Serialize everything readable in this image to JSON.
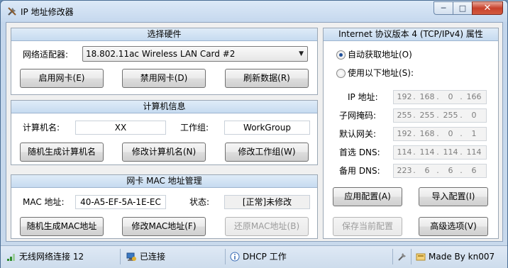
{
  "window": {
    "title": "IP 地址修改器",
    "controls": {
      "minimize": "─",
      "maximize": "□",
      "close": "✕"
    }
  },
  "hardware": {
    "header": "选择硬件",
    "adapter_label": "网络适配器:",
    "adapter_value": "18.802.11ac Wireless LAN Card #2",
    "buttons": {
      "enable": "启用网卡(E)",
      "disable": "禁用网卡(D)",
      "refresh": "刷新数据(R)"
    }
  },
  "computer": {
    "header": "计算机信息",
    "name_label": "计算机名:",
    "name_value": "XX",
    "workgroup_label": "工作组:",
    "workgroup_value": "WorkGroup",
    "buttons": {
      "random_name": "随机生成计算机名",
      "modify_name": "修改计算机名(N)",
      "modify_workgroup": "修改工作组(W)"
    }
  },
  "mac": {
    "header": "网卡 MAC 地址管理",
    "mac_label": "MAC 地址:",
    "mac_value": "40-A5-EF-5A-1E-EC",
    "status_label": "状态:",
    "status_value": "[正常]未修改",
    "buttons": {
      "random_mac": "随机生成MAC地址",
      "modify_mac": "修改MAC地址(F)",
      "restore_mac": "还原MAC地址(B)"
    }
  },
  "ipv4": {
    "header": "Internet 协议版本 4 (TCP/IPv4) 属性",
    "auto_label": "自动获取地址(O)",
    "manual_label": "使用以下地址(S):",
    "selected": "auto",
    "fields": [
      {
        "label": "IP 地址:",
        "octets": [
          "192",
          "168",
          "0",
          "166"
        ]
      },
      {
        "label": "子网掩码:",
        "octets": [
          "255",
          "255",
          "255",
          "0"
        ]
      },
      {
        "label": "默认网关:",
        "octets": [
          "192",
          "168",
          "0",
          "1"
        ]
      },
      {
        "label": "首选 DNS:",
        "octets": [
          "114",
          "114",
          "114",
          "114"
        ]
      },
      {
        "label": "备用 DNS:",
        "octets": [
          "223",
          "6",
          "6",
          "6"
        ]
      }
    ],
    "buttons": {
      "apply": "应用配置(A)",
      "import": "导入配置(I)",
      "save": "保存当前配置",
      "advanced": "高级选项(V)"
    }
  },
  "statusbar": {
    "connection_name": "无线网络连接 12",
    "connection_state": "已连接",
    "dhcp": "DHCP 工作",
    "author": "Made By kn007"
  }
}
